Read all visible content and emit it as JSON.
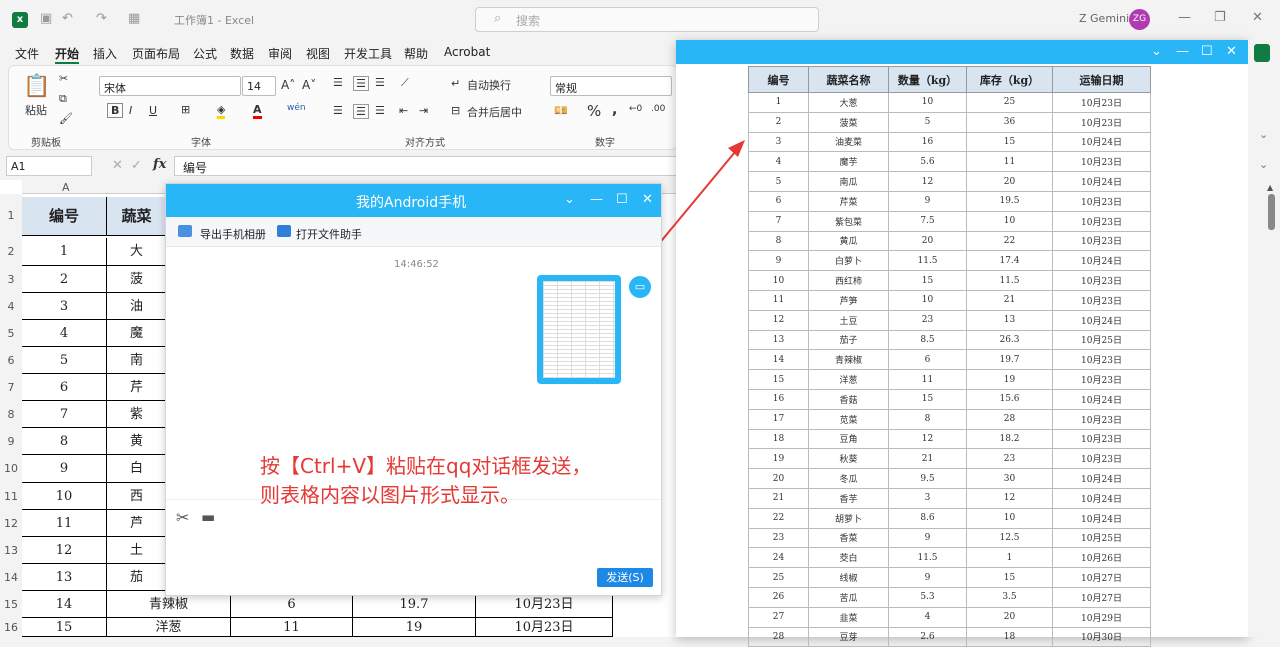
{
  "excel": {
    "app_title": "工作簿1 - Excel",
    "search_placeholder": "搜索",
    "user_name": "Z Gemini",
    "user_initials": "ZG",
    "menu": [
      "文件",
      "开始",
      "插入",
      "页面布局",
      "公式",
      "数据",
      "审阅",
      "视图",
      "开发工具",
      "帮助",
      "Acrobat"
    ],
    "ribbon": {
      "paste": "粘贴",
      "clipboard": "剪贴板",
      "font_name": "宋体",
      "font_size": "14",
      "font_group": "字体",
      "wrap_text": "自动换行",
      "merge_center": "合并后居中",
      "align_group": "对齐方式",
      "number_format": "常规",
      "number_group": "数字"
    },
    "name_box": "A1",
    "formula": "编号",
    "column_header": "A",
    "row_numbers": [
      "1",
      "2",
      "3",
      "4",
      "5",
      "6",
      "7",
      "8",
      "9",
      "10",
      "11",
      "12",
      "13",
      "14",
      "15",
      "16"
    ],
    "col1_values": [
      "1",
      "2",
      "3",
      "4",
      "5",
      "6",
      "7",
      "8",
      "9",
      "10",
      "11",
      "12",
      "13"
    ],
    "col2_values": [
      "大",
      "菠",
      "油",
      "魔",
      "南",
      "芹",
      "紫",
      "黄",
      "白",
      "西",
      "芦",
      "土",
      "茄"
    ],
    "header_row": [
      "编号",
      "蔬菜"
    ],
    "visible_rows": [
      {
        "a": "14",
        "b": "青辣椒",
        "c": "6",
        "d": "19.7",
        "e": "10月23日"
      },
      {
        "a": "15",
        "b": "洋葱",
        "c": "11",
        "d": "19",
        "e": "10月23日"
      }
    ]
  },
  "qq_window": {
    "title": "我的Android手机",
    "export_album": "导出手机相册",
    "open_assistant": "打开文件助手",
    "timestamp": "14:46:52",
    "send_button": "发送(S)"
  },
  "annotation": {
    "line1": "按【Ctrl+V】粘贴在qq对话框发送，",
    "line2": "则表格内容以图片形式显示。"
  },
  "image_table": {
    "headers": [
      "编号",
      "蔬菜名称",
      "数量（kg）",
      "库存（kg）",
      "运输日期"
    ],
    "rows": [
      [
        "1",
        "大葱",
        "10",
        "25",
        "10月23日"
      ],
      [
        "2",
        "菠菜",
        "5",
        "36",
        "10月23日"
      ],
      [
        "3",
        "油麦菜",
        "16",
        "15",
        "10月24日"
      ],
      [
        "4",
        "魔芋",
        "5.6",
        "11",
        "10月23日"
      ],
      [
        "5",
        "南瓜",
        "12",
        "20",
        "10月24日"
      ],
      [
        "6",
        "芹菜",
        "9",
        "19.5",
        "10月23日"
      ],
      [
        "7",
        "紫包菜",
        "7.5",
        "10",
        "10月23日"
      ],
      [
        "8",
        "黄瓜",
        "20",
        "22",
        "10月23日"
      ],
      [
        "9",
        "白萝卜",
        "11.5",
        "17.4",
        "10月24日"
      ],
      [
        "10",
        "西红柿",
        "15",
        "11.5",
        "10月23日"
      ],
      [
        "11",
        "芦笋",
        "10",
        "21",
        "10月23日"
      ],
      [
        "12",
        "土豆",
        "23",
        "13",
        "10月24日"
      ],
      [
        "13",
        "茄子",
        "8.5",
        "26.3",
        "10月25日"
      ],
      [
        "14",
        "青辣椒",
        "6",
        "19.7",
        "10月23日"
      ],
      [
        "15",
        "洋葱",
        "11",
        "19",
        "10月23日"
      ],
      [
        "16",
        "香菇",
        "15",
        "15.6",
        "10月24日"
      ],
      [
        "17",
        "苋菜",
        "8",
        "28",
        "10月23日"
      ],
      [
        "18",
        "豆角",
        "12",
        "18.2",
        "10月23日"
      ],
      [
        "19",
        "秋葵",
        "21",
        "23",
        "10月23日"
      ],
      [
        "20",
        "冬瓜",
        "9.5",
        "30",
        "10月24日"
      ],
      [
        "21",
        "香芋",
        "3",
        "12",
        "10月24日"
      ],
      [
        "22",
        "胡萝卜",
        "8.6",
        "10",
        "10月24日"
      ],
      [
        "23",
        "香菜",
        "9",
        "12.5",
        "10月25日"
      ],
      [
        "24",
        "茭白",
        "11.5",
        "1",
        "10月26日"
      ],
      [
        "25",
        "线椒",
        "9",
        "15",
        "10月27日"
      ],
      [
        "26",
        "苦瓜",
        "5.3",
        "3.5",
        "10月27日"
      ],
      [
        "27",
        "韭菜",
        "4",
        "20",
        "10月29日"
      ],
      [
        "28",
        "豆芽",
        "2.6",
        "18",
        "10月30日"
      ]
    ]
  },
  "colors": {
    "qq_blue": "#29b6f6",
    "excel_green": "#107c41",
    "annotation_red": "#e53935",
    "header_fill": "#d9e4f1"
  }
}
